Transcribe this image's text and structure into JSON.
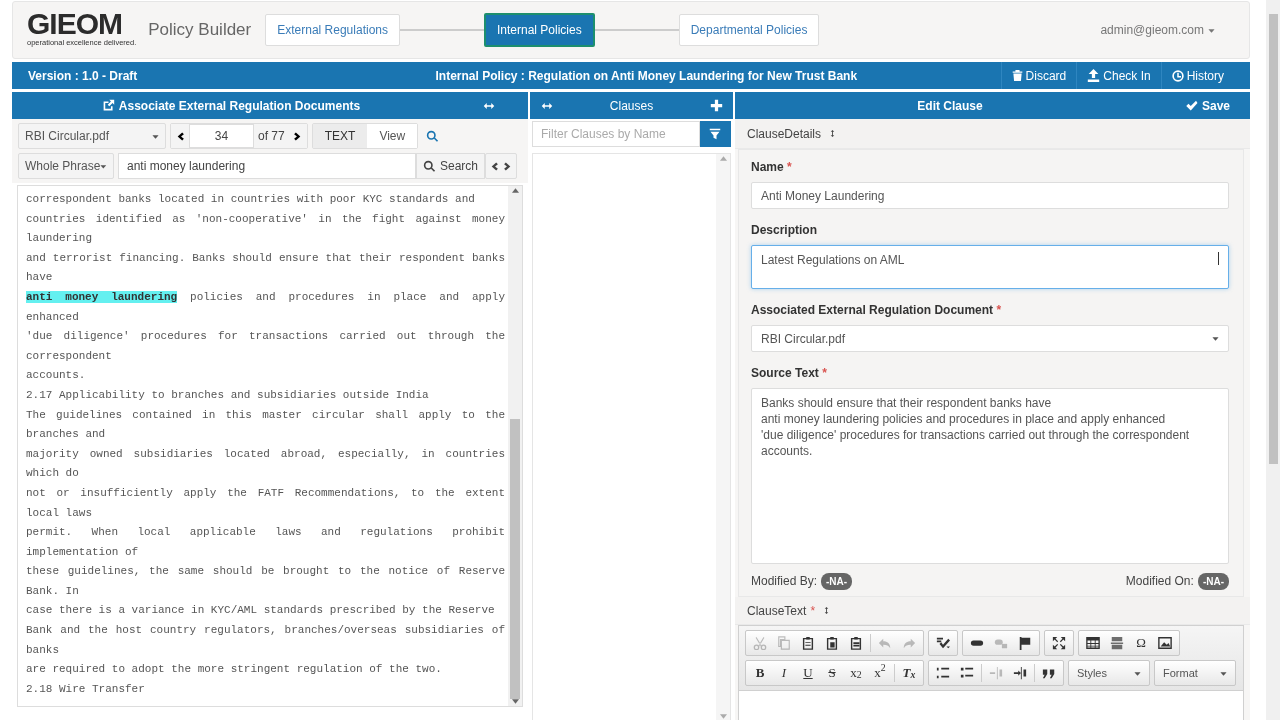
{
  "header": {
    "logo": "GIEOM",
    "tagline": "operational excellence delivered.",
    "app_title": "Policy Builder",
    "steps": [
      {
        "label": "External Regulations",
        "selected": false
      },
      {
        "label": "Internal Policies",
        "selected": true
      },
      {
        "label": "Departmental Policies",
        "selected": false
      }
    ],
    "user": "admin@gieom.com"
  },
  "policy_bar": {
    "version": "Version : 1.0 - Draft",
    "title": "Internal Policy : Regulation on Anti Money Laundering for New Trust Bank",
    "actions": [
      "Discard",
      "Check In",
      "History"
    ]
  },
  "documents_panel": {
    "title": "Associate External Regulation Documents",
    "document": "RBI Circular.pdf",
    "page": "34",
    "page_count": "of 77",
    "view_modes": [
      {
        "label": "TEXT",
        "selected": true
      },
      {
        "label": "View",
        "selected": false
      }
    ],
    "match_mode": "Whole Phrase",
    "search_query": "anti money laundering",
    "search_button": "Search",
    "paragraphs": [
      {
        "segments": [
          {
            "text": "correspondent banks located in countries with poor KYC standards and",
            "highlighted": false
          }
        ]
      },
      {
        "segments": [
          {
            "text": "countries identified as 'non-cooperative' in the fight against money laundering",
            "highlighted": false
          }
        ]
      },
      {
        "segments": [
          {
            "text": "and terrorist financing. Banks should ensure that their respondent banks have",
            "highlighted": false
          }
        ]
      },
      {
        "segments": [
          {
            "text": "anti money laundering",
            "highlighted": true
          },
          {
            "text": " policies and procedures in place and apply enhanced",
            "highlighted": false
          }
        ]
      },
      {
        "segments": [
          {
            "text": "'due diligence' procedures for transactions carried out through the correspondent",
            "highlighted": false
          }
        ]
      },
      {
        "segments": [
          {
            "text": "accounts.",
            "highlighted": false
          }
        ]
      },
      {
        "segments": [
          {
            "text": "2.17 Applicability to branches and subsidiaries outside India",
            "highlighted": false
          }
        ]
      },
      {
        "segments": [
          {
            "text": "The guidelines contained in this master circular shall apply to the branches and",
            "highlighted": false
          }
        ]
      },
      {
        "segments": [
          {
            "text": "majority owned subsidiaries located abroad, especially, in countries which do",
            "highlighted": false
          }
        ]
      },
      {
        "segments": [
          {
            "text": "not or insufficiently apply the FATF Recommendations, to the extent local laws",
            "highlighted": false
          }
        ]
      },
      {
        "segments": [
          {
            "text": "permit. When local applicable laws and regulations prohibit implementation of",
            "highlighted": false
          }
        ]
      },
      {
        "segments": [
          {
            "text": "these guidelines, the same should be brought to the notice of Reserve Bank. In",
            "highlighted": false
          }
        ]
      },
      {
        "segments": [
          {
            "text": "case there is a variance in KYC/AML standards prescribed by the Reserve",
            "highlighted": false
          }
        ]
      },
      {
        "segments": [
          {
            "text": "Bank and the host country regulators, branches/overseas subsidiaries of banks",
            "highlighted": false
          }
        ]
      },
      {
        "segments": [
          {
            "text": "are required to adopt the more stringent regulation of the two.",
            "highlighted": false
          }
        ]
      },
      {
        "segments": [
          {
            "text": "2.18 Wire Transfer",
            "highlighted": false
          }
        ]
      }
    ]
  },
  "clauses_panel": {
    "title": "Clauses",
    "filter_placeholder": "Filter Clauses by Name"
  },
  "edit_panel": {
    "title": "Edit Clause",
    "save": "Save",
    "details_title": "ClauseDetails",
    "fields": [
      {
        "kind": "input",
        "label": "Name",
        "marker": "*",
        "value": "Anti Money Laundering",
        "focused": false
      },
      {
        "kind": "textarea",
        "label": "Description",
        "value": "Latest Regulations on AML",
        "focused": true
      },
      {
        "kind": "select",
        "label": "Associated External Regulation Document",
        "marker": "*",
        "value": "RBI Circular.pdf",
        "focused": false
      },
      {
        "kind": "textarea",
        "label": "Source Text",
        "marker": "*",
        "value": "Banks should ensure that their respondent banks have\nanti money laundering policies and procedures in place and apply enhanced\n'due diligence' procedures for transactions carried out through the correspondent\naccounts.",
        "focused": false
      }
    ],
    "modified_by_label": "Modified By:",
    "modified_by": "-NA-",
    "modified_on_label": "Modified On:",
    "modified_on": "-NA-",
    "clause_text_label": "ClauseText",
    "clause_text_marker": "*",
    "editor_toolbar": [
      [
        [
          {
            "kind": "icon",
            "disabled": true
          },
          {
            "kind": "icon",
            "disabled": true
          },
          {
            "kind": "icon",
            "disabled": false
          },
          {
            "kind": "icon",
            "disabled": false
          },
          {
            "kind": "icon",
            "disabled": false
          },
          {
            "kind": "separator"
          },
          {
            "kind": "icon",
            "disabled": true
          },
          {
            "kind": "icon",
            "disabled": true
          }
        ],
        [
          {
            "kind": "icon",
            "disabled": false
          }
        ],
        [
          {
            "kind": "icon",
            "disabled": false
          },
          {
            "kind": "icon",
            "disabled": true
          },
          {
            "kind": "icon",
            "disabled": false
          }
        ],
        [
          {
            "kind": "icon",
            "disabled": false
          }
        ],
        [
          {
            "kind": "icon",
            "disabled": false
          },
          {
            "kind": "icon",
            "disabled": false
          },
          {
            "kind": "glyph",
            "label": "Ω",
            "disabled": false
          },
          {
            "kind": "icon",
            "disabled": false
          }
        ]
      ],
      [
        [
          {
            "kind": "glyph",
            "label": "B",
            "disabled": false
          },
          {
            "kind": "glyph",
            "label": "I",
            "disabled": false
          },
          {
            "kind": "glyph",
            "label": "U",
            "disabled": false
          },
          {
            "kind": "glyph",
            "label": "S",
            "disabled": false
          },
          {
            "kind": "glyph",
            "label": "x$_{2}$",
            "disabled": false
          },
          {
            "kind": "glyph",
            "label": "x$^{2}$",
            "disabled": false
          },
          {
            "kind": "separator"
          },
          {
            "kind": "glyph",
            "label": "T$_{x}$",
            "disabled": false
          }
        ],
        [
          {
            "kind": "icon",
            "disabled": false
          },
          {
            "kind": "icon",
            "disabled": false
          },
          {
            "kind": "separator"
          },
          {
            "kind": "icon",
            "disabled": true
          },
          {
            "kind": "icon",
            "disabled": false
          },
          {
            "kind": "separator"
          },
          {
            "kind": "icon",
            "disabled": false
          }
        ],
        [
          {
            "kind": "combo",
            "label": "Styles"
          }
        ],
        [
          {
            "kind": "combo",
            "label": "Format"
          }
        ]
      ]
    ]
  }
}
